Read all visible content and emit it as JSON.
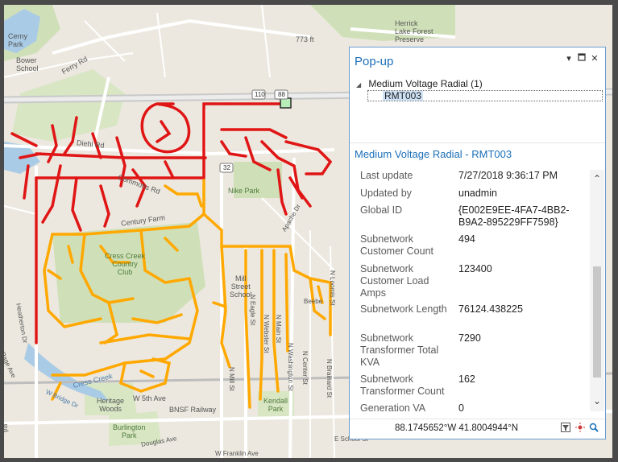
{
  "map": {
    "labels": {
      "cerny_park": "Cerny\nPark",
      "bower_school": "Bower\nSchool",
      "ferry_rd": "Ferry Rd",
      "ft_773": "773 ft",
      "herrick": "Herrick\nLake Forest\nPreserve",
      "diehl_rd": "Diehl Rd",
      "commons_rd": "Commons Rd",
      "nike_park": "Nike Park",
      "century_farm": "Century Farm",
      "apache_dr": "Apache Dr",
      "cress_creek_club": "Cress Creek\nCountry\nClub",
      "mill_street_school": "Mill\nStreet\nSchool",
      "heatherton": "Heatherton Dr",
      "page_ave": "Page Ave",
      "cress_creek": "Cress Creek",
      "heritage_woods": "Heritage\nWoods",
      "w_5th_ave": "W 5th Ave",
      "bnsf": "BNSF Railway",
      "burlington_park": "Burlington\nPark",
      "kendall_park": "Kendall\nPark",
      "n_eagle": "N Eagle St",
      "n_webster": "N Webster St",
      "n_main": "N Main St",
      "n_washington": "N Washington St",
      "n_center": "N Center St",
      "n_brainard": "N Brainard St",
      "n_loomis": "N Loomis St",
      "n_mill": "N Mill St",
      "beebe": "Beebe",
      "w_bridge": "W Bridge Dr",
      "douglas": "Douglas Ave",
      "e_school": "E School St",
      "w_franklin": "W Franklin Ave",
      "rd_110": "110",
      "rd_88": "88",
      "rd_32": "32",
      "rd": "Rd"
    },
    "colors": {
      "background": "#ece8df",
      "park": "#cfe0b8",
      "water": "#a9cbe6",
      "road": "#ffffff",
      "highway": "#d4d4d4",
      "red_circuit": "#e01515",
      "orange_circuit": "#ffa800"
    }
  },
  "popup": {
    "title": "Pop-up",
    "controls": {
      "pin": "▾",
      "restore": "🗖",
      "close": "✕"
    },
    "tree": {
      "layer_label": "Medium Voltage Radial  (1)",
      "feature_label": "RMT003"
    },
    "feature_title": "Medium Voltage Radial - RMT003",
    "attributes": [
      {
        "key": "Last update",
        "value": "7/27/2018 9:36:17 PM"
      },
      {
        "key": "Updated by",
        "value": "unadmin"
      },
      {
        "key": "Global ID",
        "value": "{E002E9EE-4FA7-4BB2-B9A2-895229FF7598}"
      },
      {
        "key": "Subnetwork Customer Count",
        "value": "494"
      },
      {
        "key": "Subnetwork Customer Load Amps",
        "value": "123400"
      },
      {
        "key": "Subnetwork Length",
        "value": "76124.438225"
      },
      {
        "key": "Subnetwork Transformer Total KVA",
        "value": "7290"
      },
      {
        "key": "Subnetwork Transformer Count",
        "value": "162"
      },
      {
        "key": "Generation VA",
        "value": "0"
      }
    ],
    "footer": {
      "coordinates": "88.1745652°W 41.8004944°N",
      "icons": [
        "filter-icon",
        "flash-icon",
        "zoom-icon"
      ]
    },
    "accent": "#1b6fb8"
  }
}
